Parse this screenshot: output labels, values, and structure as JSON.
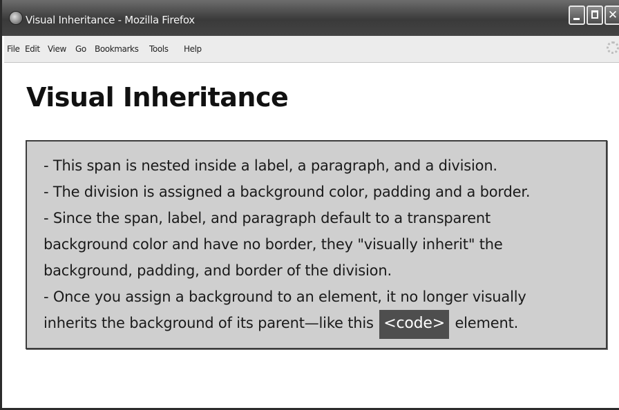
{
  "window": {
    "title": "Visual Inheritance - Mozilla Firefox",
    "buttons": {
      "close_glyph": "✕"
    }
  },
  "menubar": {
    "items": [
      "File",
      "Edit",
      "View",
      "Go",
      "Bookmarks",
      "Tools",
      "Help"
    ]
  },
  "page": {
    "heading": "Visual Inheritance",
    "lines": [
      "- This span is nested inside a label, a paragraph, and a division.",
      "- The division is assigned a background color, padding and a border.",
      "- Since the span, label, and paragraph default to a transparent",
      "background color and have no border, they \"visually inherit\" the",
      "background, padding, and border of the division.",
      "- Once you assign a background to an element, it no longer visually"
    ],
    "last_line": {
      "before": "inherits the background of its parent—like this",
      "code": "<code>",
      "after": "element."
    }
  },
  "colors": {
    "box_background": "#cfcfcf",
    "code_background": "#4e4e4e",
    "titlebar": "#4a4a4a"
  },
  "icons": {
    "app": "firefox-icon",
    "minimize": "minimize-icon",
    "maximize": "maximize-icon",
    "close": "close-icon",
    "throbber": "throbber-icon"
  }
}
